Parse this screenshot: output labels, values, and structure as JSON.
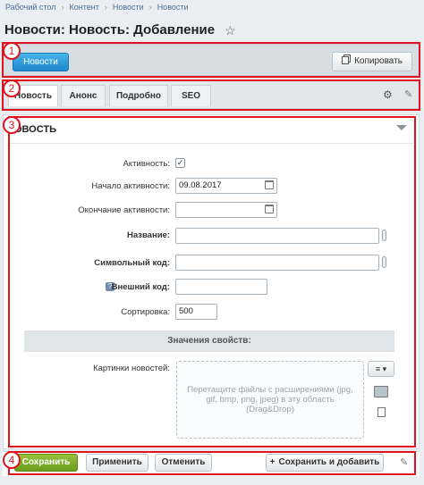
{
  "breadcrumbs": [
    "Рабочий стол",
    "Контент",
    "Новости",
    "Новости"
  ],
  "page_title": "Новости: Новость: Добавление",
  "annotations": [
    "1",
    "2",
    "3",
    "4"
  ],
  "toolbar": {
    "news_button": "Новости",
    "copy_button": "Копировать"
  },
  "tabs": [
    "Новость",
    "Анонс",
    "Подробно",
    "SEO"
  ],
  "section_title": "НОВОСТЬ",
  "form": {
    "active_label": "Активность:",
    "active_checked": true,
    "start_label": "Начало активности:",
    "start_value": "09.08.2017",
    "end_label": "Окончание активности:",
    "end_value": "",
    "name_label": "Название:",
    "name_value": "",
    "code_label": "Символьный код:",
    "code_value": "",
    "ext_code_label": "Внешний код:",
    "ext_code_value": "",
    "sort_label": "Сортировка:",
    "sort_value": "500",
    "props_header": "Значения свойств:",
    "images_label": "Картинки новостей:",
    "dropzone_text": "Перетащите файлы с расширениями (jpg, gif, bmp, png, jpeg) в эту область (Drag&Drop)"
  },
  "footer": {
    "save": "Сохранить",
    "apply": "Применить",
    "cancel": "Отменить",
    "save_add": "Сохранить и добавить"
  }
}
